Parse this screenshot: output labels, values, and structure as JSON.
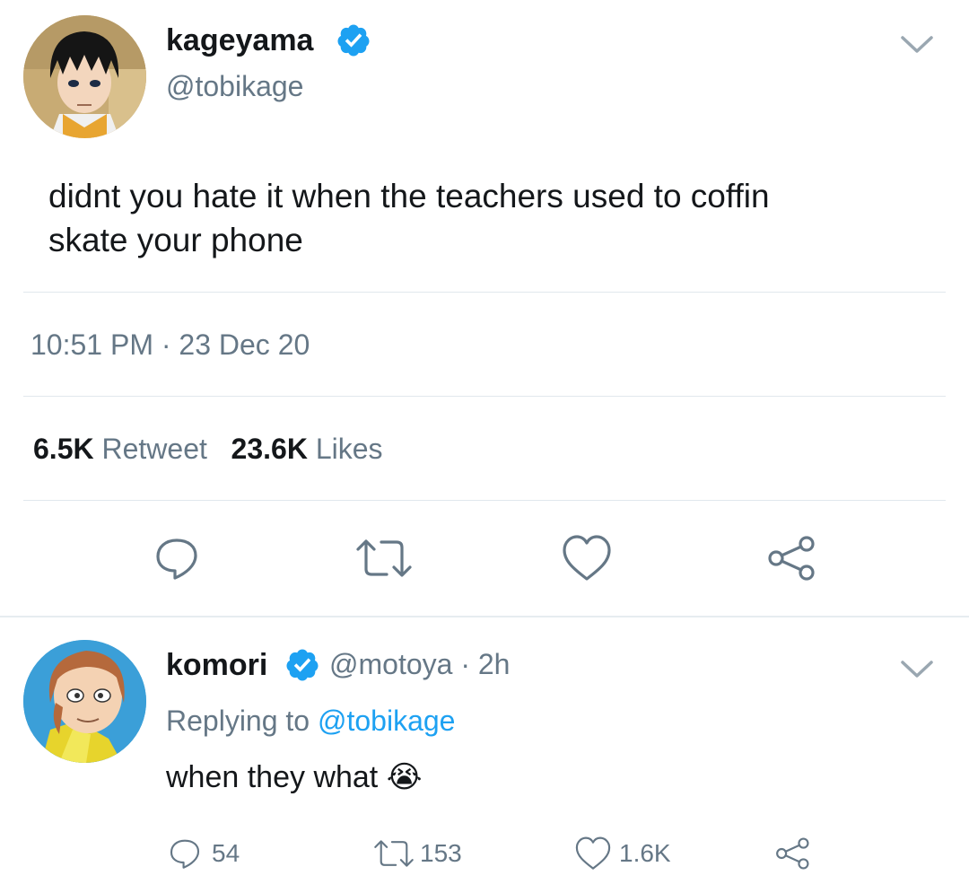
{
  "main_tweet": {
    "display_name": "kageyama",
    "handle": "@tobikage",
    "text_line1": "didnt you hate it when the teachers used to coffin",
    "text_line2": "skate your phone",
    "time": "10:51 PM",
    "separator": "·",
    "date": "23 Dec 20",
    "retweets_count": "6.5K",
    "retweets_label": "Retweet",
    "likes_count": "23.6K",
    "likes_label": "Likes"
  },
  "reply_tweet": {
    "display_name": "komori",
    "handle": "@motoya",
    "time_ago": "· 2h",
    "replying_prefix": "Replying to ",
    "replying_to": "@tobikage",
    "text": "when they what",
    "emoji": "😭",
    "reply_count": "54",
    "retweet_count": "153",
    "like_count": "1.6K"
  },
  "colors": {
    "verified": "#1da1f2",
    "link": "#1da1f2",
    "muted": "#657786",
    "text": "#14171a"
  },
  "icons": {
    "verified": "verified-badge-icon",
    "chevron": "chevron-down-icon",
    "reply": "reply-icon",
    "retweet": "retweet-icon",
    "like": "heart-icon",
    "share": "share-icon"
  }
}
